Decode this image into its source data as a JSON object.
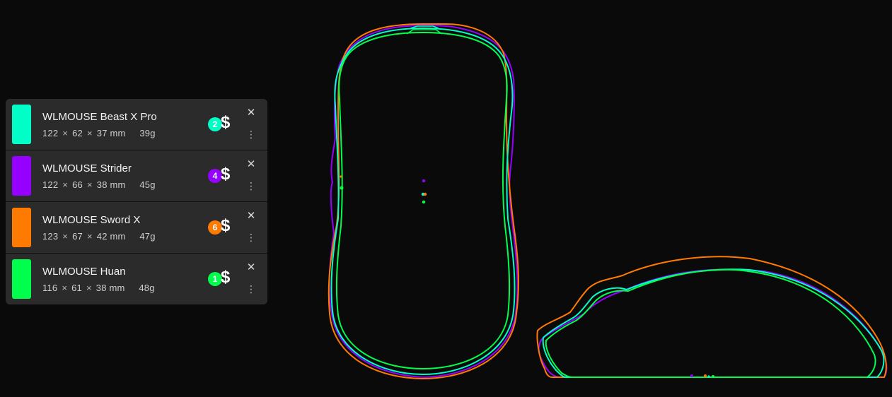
{
  "mice": [
    {
      "name": "WLMOUSE Beast X Pro",
      "length": "122",
      "width": "62",
      "height": "37",
      "unit": "mm",
      "weight": "39g",
      "rank": "2",
      "price_icon": "$",
      "color": "#00ffc6",
      "close": "✕",
      "more": "⋮"
    },
    {
      "name": "WLMOUSE Strider",
      "length": "122",
      "width": "66",
      "height": "38",
      "unit": "mm",
      "weight": "45g",
      "rank": "4",
      "price_icon": "$",
      "color": "#9600ff",
      "close": "✕",
      "more": "⋮"
    },
    {
      "name": "WLMOUSE Sword X",
      "length": "123",
      "width": "67",
      "height": "42",
      "unit": "mm",
      "weight": "47g",
      "rank": "6",
      "price_icon": "$",
      "color": "#ff7a00",
      "close": "✕",
      "more": "⋮"
    },
    {
      "name": "WLMOUSE Huan",
      "length": "116",
      "width": "61",
      "height": "38",
      "unit": "mm",
      "weight": "48g",
      "rank": "1",
      "price_icon": "$",
      "color": "#00ff4d",
      "close": "✕",
      "more": "⋮"
    }
  ],
  "dimension_separator": "×",
  "colors": {
    "background": "#0a0a0a",
    "panel": "#2b2b2b"
  },
  "icons": {
    "close": "close-icon",
    "more": "more-vertical-icon",
    "price": "dollar-icon"
  }
}
